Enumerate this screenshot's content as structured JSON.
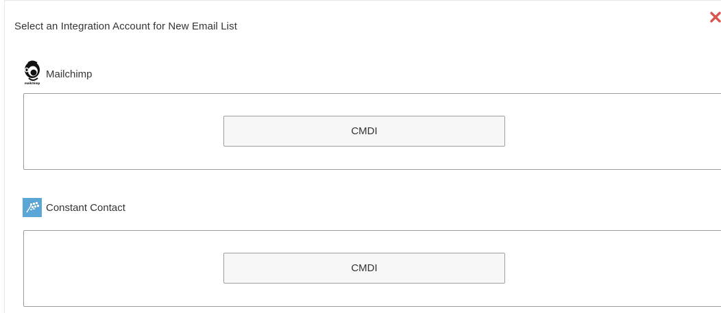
{
  "dialog": {
    "title": "Select an Integration Account for New Email List"
  },
  "providers": [
    {
      "name": "Mailchimp",
      "logo_icon": "mailchimp-freddie-icon",
      "logo_caption": "mailchimp",
      "accounts": [
        {
          "label": "CMDI"
        }
      ]
    },
    {
      "name": "Constant Contact",
      "logo_icon": "constant-contact-flag-icon",
      "accounts": [
        {
          "label": "CMDI"
        }
      ]
    }
  ],
  "colors": {
    "close_icon": "#d9534f",
    "constant_contact_logo_bg": "#5aa6d6",
    "box_border": "#9a9a9a",
    "button_bg": "#f7f7f7"
  }
}
